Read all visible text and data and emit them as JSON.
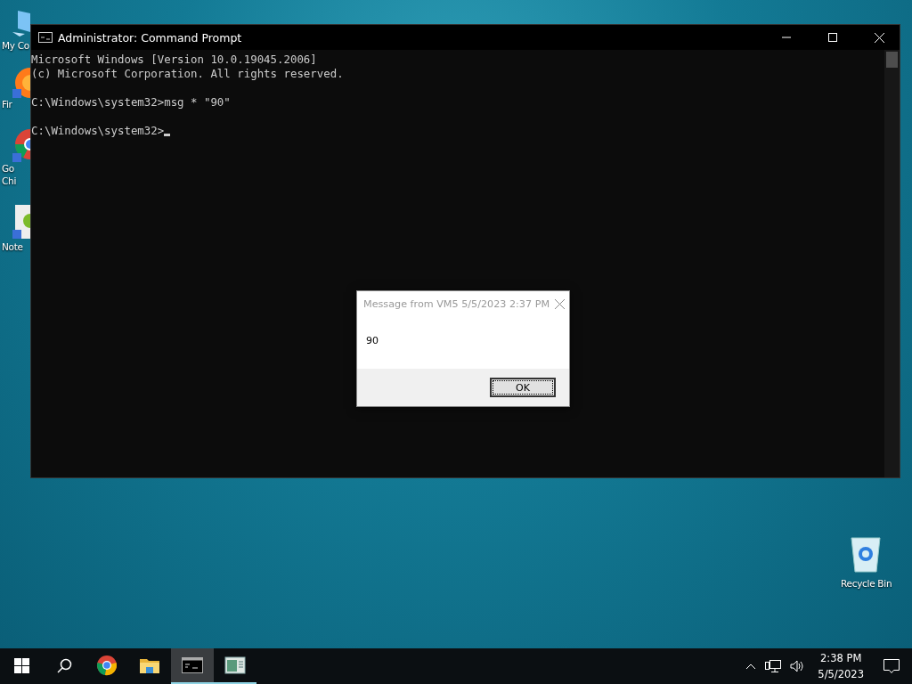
{
  "desktop_icons": [
    {
      "label": [
        "My Co"
      ]
    },
    {
      "label": [
        "Fir"
      ]
    },
    {
      "label": [
        "Go",
        "Chi"
      ]
    },
    {
      "label": [
        "Note"
      ]
    }
  ],
  "recycle_bin": {
    "label": "Recycle Bin"
  },
  "console_window": {
    "title": "Administrator:  Command Prompt",
    "blocks": [
      [
        "Microsoft Windows [Version 10.0.19045.2006]",
        "(c) Microsoft Corporation. All rights reserved."
      ],
      [
        "C:\\Windows\\system32>msg * \"90\""
      ],
      [
        "C:\\Windows\\system32>"
      ]
    ],
    "cursor": true
  },
  "message_dialog": {
    "title": "Message from VM5 5/5/2023 2:37 PM",
    "message": "90",
    "button": "OK"
  },
  "taskbar": {
    "apps": [
      {
        "kind": "chrome",
        "selected": false,
        "running": false
      },
      {
        "kind": "folder",
        "selected": false,
        "running": false
      },
      {
        "kind": "console",
        "selected": true,
        "running": true
      },
      {
        "kind": "notepad",
        "selected": false,
        "running": true
      }
    ],
    "time": "2:38 PM",
    "date": "5/5/2023"
  }
}
